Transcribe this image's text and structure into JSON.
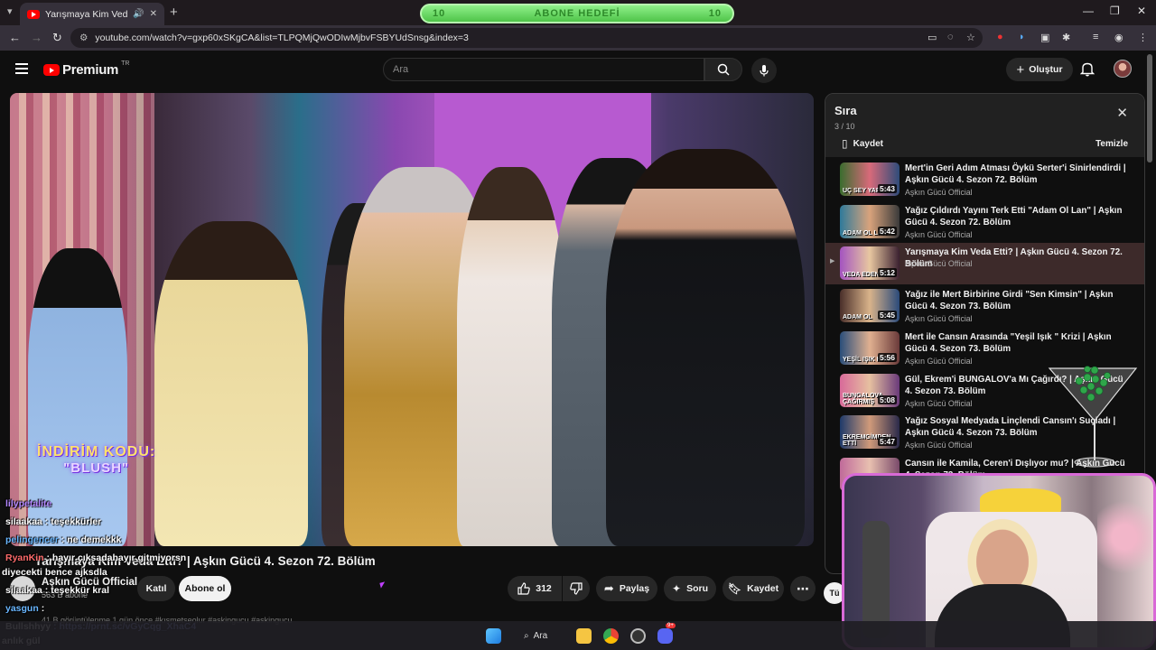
{
  "browser": {
    "tab_title": "Yarışmaya Kim Veda Etti? | A",
    "url": "youtube.com/watch?v=gxp60xSKgCA&list=TLPQMjQwODIwMjbvFSBYUdSnsg&index=3"
  },
  "stream_overlay": {
    "subscriber_goal_label": "ABONE HEDEFİ",
    "goal_left": "10",
    "goal_right": "10",
    "promo_label": "İNDİRİM KODU:",
    "promo_code": "\"BLUSH\""
  },
  "youtube": {
    "logo_text": "Premium",
    "logo_country": "TR",
    "search_placeholder": "Ara",
    "create_label": "Oluştur"
  },
  "video": {
    "title": "Yarışmaya Kim Veda Etti? | Aşkın Gücü 4. Sezon 72. Bölüm",
    "channel_name": "Aşkın Gücü Official",
    "channel_subs": "563 B abone",
    "join_label": "Katıl",
    "subscribe_label": "Abone ol",
    "like_count": "312",
    "share_label": "Paylaş",
    "ask_label": "Soru",
    "save_label": "Kaydet",
    "description_line": "41 B görüntülenme  1 gün önce  #kısmetseolur #askingucu #askingucu"
  },
  "queue": {
    "title": "Sıra",
    "position": "3 / 10",
    "save_label": "Kaydet",
    "clear_label": "Temizle",
    "items": [
      {
        "title": "Mert'in Geri Adım Atması Öykü Serter'i Sinirlendirdi | Aşkın Gücü 4. Sezon 72. Bölüm",
        "channel": "Aşkın Gücü Official",
        "duration": "5:43",
        "thumb_text": "UÇ SEY YAPAM"
      },
      {
        "title": "Yağız Çıldırdı Yayını Terk Etti \"Adam Ol Lan\" | Aşkın Gücü 4. Sezon 72. Bölüm",
        "channel": "Aşkın Gücü Official",
        "duration": "5:42",
        "thumb_text": "ADAM OL LAN"
      },
      {
        "title": "Yarışmaya Kim Veda Etti? | Aşkın Gücü 4. Sezon 72. Bölüm",
        "channel": "Aşkın Gücü Official",
        "duration": "5:12",
        "thumb_text": "VEDA EDEN İSİM"
      },
      {
        "title": "Yağız ile Mert Birbirine Girdi \"Sen Kimsin\" | Aşkın Gücü 4. Sezon 73. Bölüm",
        "channel": "Aşkın Gücü Official",
        "duration": "5:45",
        "thumb_text": "ADAM OL"
      },
      {
        "title": "Mert ile Cansın Arasında \"Yeşil Işık \" Krizi | Aşkın Gücü 4. Sezon 73. Bölüm",
        "channel": "Aşkın Gücü Official",
        "duration": "5:56",
        "thumb_text": "YEŞİL IŞIK KRİZİ"
      },
      {
        "title": "Gül, Ekrem'i BUNGALOV'a Mı Çağırdı? | Aşkın Gücü 4. Sezon 73. Bölüm",
        "channel": "Aşkın Gücü Official",
        "duration": "5:08",
        "thumb_text": "BUNGALOVA ÇAĞIRMIŞ"
      },
      {
        "title": "Yağız Sosyal Medyada Linçlendi Cansın'ı Suçladı | Aşkın Gücü 4. Sezon 73. Bölüm",
        "channel": "Aşkın Gücü Official",
        "duration": "5:47",
        "thumb_text": "EKREMGİMDEN ETTİ"
      },
      {
        "title": "Cansın ile Kamila, Ceren'i Dışlıyor mu? | Aşkın Gücü 4. Sezon 73. Bölüm",
        "channel": "",
        "duration": "",
        "thumb_text": ""
      }
    ]
  },
  "chat": [
    {
      "user": "lilypetalite",
      "msg": "",
      "color": "#b388ff"
    },
    {
      "user": "silaakaa",
      "msg": ": teşekkürler",
      "color": "#ffffff"
    },
    {
      "user": "pelingencer",
      "msg": ": ne demekkk",
      "color": "#6ab7ff"
    },
    {
      "user": "RyanKin",
      "msg": ": hayır çıksadahayır gitmiyorsn",
      "color": "#ff6b6b"
    },
    {
      "user": "",
      "msg": "diyecekti bence ajksdla",
      "color": "#ffffff"
    },
    {
      "user": "silaakaa",
      "msg": ": teşekkür kral",
      "color": "#ffffff"
    },
    {
      "user": "yasgun",
      "msg": ":",
      "color": "#6ab7ff"
    },
    {
      "user": "Bullshhyy",
      "msg": ": https://prnt.sc/vGyCqg_XhaC4",
      "color": "#ffffff"
    },
    {
      "user": "",
      "msg": "anlık gül",
      "color": "#ffffff"
    }
  ],
  "taskbar": {
    "search_label": "Ara",
    "discord_badge": "9+"
  },
  "partial_button": "Tü"
}
